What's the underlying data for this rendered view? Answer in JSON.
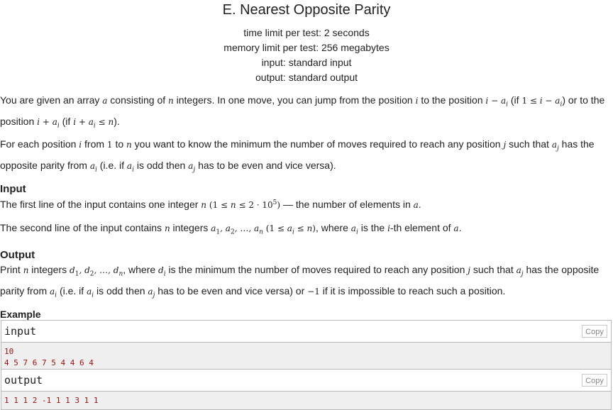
{
  "problem": {
    "title": "E. Nearest Opposite Parity",
    "limits": [
      "time limit per test: 2 seconds",
      "memory limit per test: 256 megabytes",
      "input: standard input",
      "output: standard output"
    ]
  },
  "statement": {
    "p1": {
      "t1": "You are given an array ",
      "t2": " consisting of ",
      "t3": " integers. In one move, you can jump from the position ",
      "t4": " to the position ",
      "t5": " (if ",
      "t6": ") or to the position ",
      "t7": " (if ",
      "t8": ")."
    },
    "p2": {
      "t1": "For each position ",
      "t2": " from ",
      "t3": " to ",
      "t4": " you want to know the minimum the number of moves required to reach any position ",
      "t5": " such that ",
      "t6": " has the opposite parity from ",
      "t7": " (i.e. if ",
      "t8": " is odd then ",
      "t9": " has to be even and vice versa)."
    }
  },
  "input_section": {
    "title": "Input",
    "p1": {
      "t1": "The first line of the input contains one integer ",
      "t2": " — the number of elements in ",
      "t3": "."
    },
    "p2": {
      "t1": "The second line of the input contains ",
      "t2": " integers ",
      "t3": ", where ",
      "t4": " is the ",
      "t5": "-th element of ",
      "t6": "."
    }
  },
  "output_section": {
    "title": "Output",
    "p1": {
      "t1": "Print ",
      "t2": " integers ",
      "t3": ", where ",
      "t4": " is the minimum the number of moves required to reach any position ",
      "t5": " such that ",
      "t6": " has the opposite parity from ",
      "t7": " (i.e. if ",
      "t8": " is odd then ",
      "t9": " has to be even and vice versa) or ",
      "t10": " if it is impossible to reach such a position."
    }
  },
  "example": {
    "title": "Example",
    "input_label": "input",
    "output_label": "output",
    "copy_label": "Copy",
    "input_lines": [
      "10",
      "4 5 7 6 7 5 4 4 6 4"
    ],
    "output_lines": [
      "1 1 1 2 -1 1 1 3 1 1"
    ]
  }
}
